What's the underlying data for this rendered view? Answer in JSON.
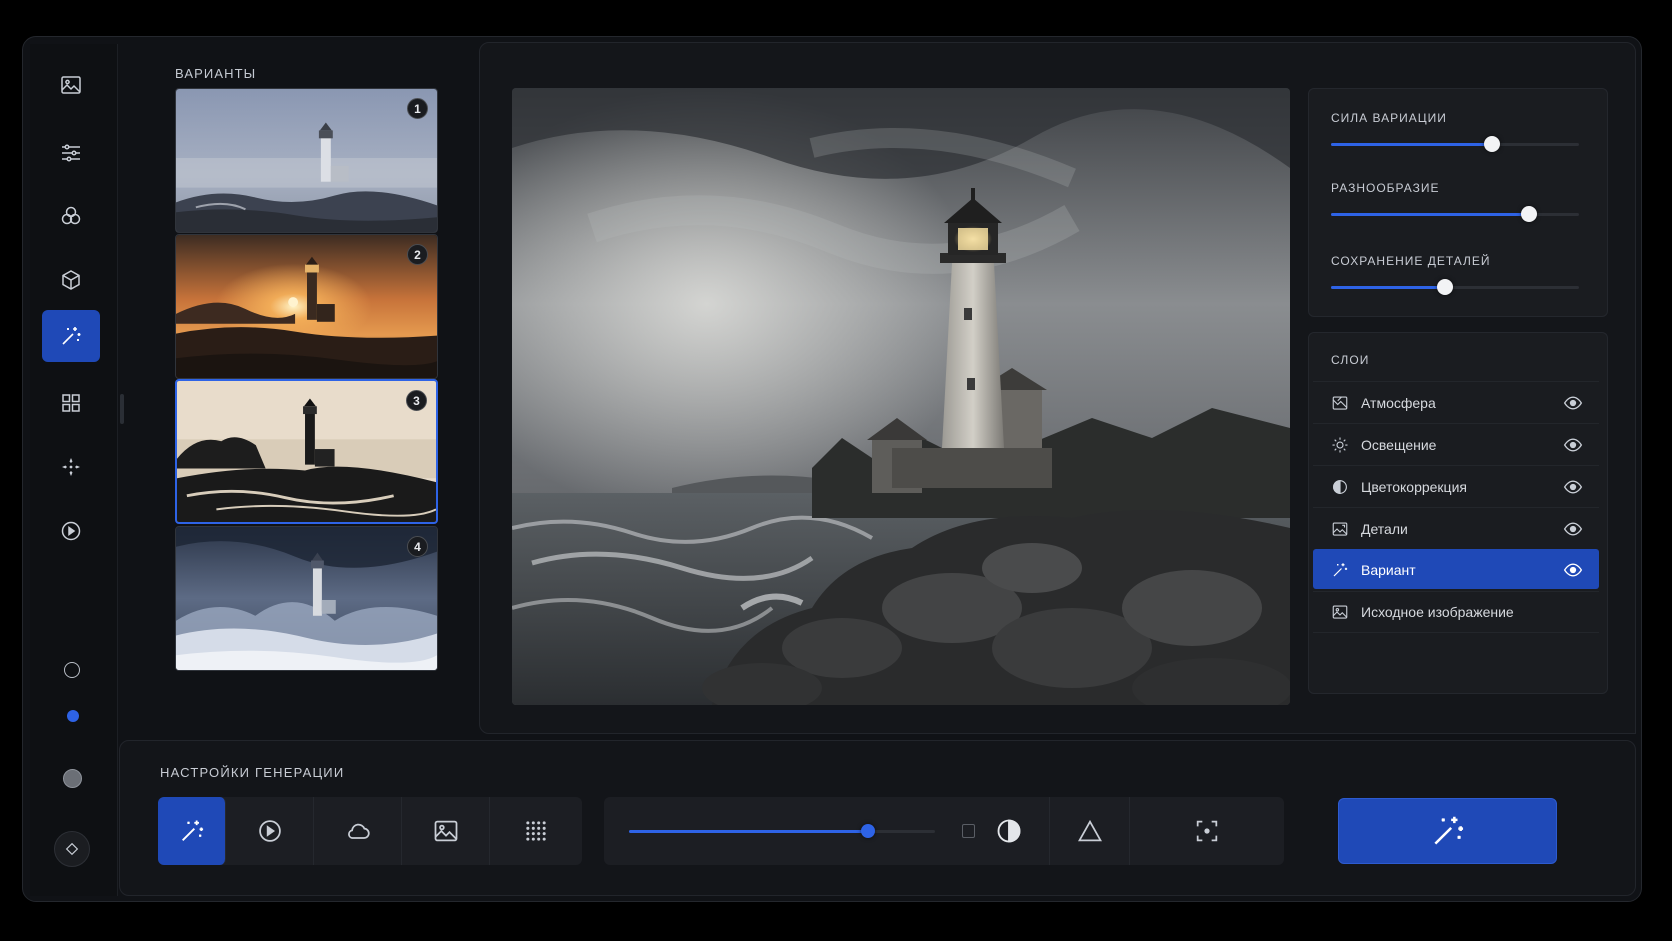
{
  "variants": {
    "title": "ВАРИАНТЫ",
    "items": [
      {
        "number": "1",
        "style": "foggy"
      },
      {
        "number": "2",
        "style": "sunset"
      },
      {
        "number": "3",
        "style": "silhouette"
      },
      {
        "number": "4",
        "style": "storm"
      }
    ],
    "selected": "3"
  },
  "rail": {
    "icons": [
      "image-icon",
      "sliders-icon",
      "blend-icon",
      "cube-icon",
      "magic-wand-icon",
      "grid-icon",
      "sparkle-move-icon",
      "half-circle-play-icon"
    ],
    "active": "magic-wand-icon"
  },
  "controls": {
    "sliders": [
      {
        "label": "СИЛА ВАРИАЦИИ",
        "value": 0.65
      },
      {
        "label": "РАЗНООБРАЗИЕ",
        "value": 0.8
      },
      {
        "label": "СОХРАНЕНИЕ ДЕТАЛЕЙ",
        "value": 0.46
      }
    ]
  },
  "layers": {
    "title": "СЛОИ",
    "items": [
      {
        "name": "Атмосфера",
        "icon": "atmosphere-icon",
        "visible": true
      },
      {
        "name": "Освещение",
        "icon": "sun-icon",
        "visible": true
      },
      {
        "name": "Цветокоррекция",
        "icon": "color-correction-icon",
        "visible": true
      },
      {
        "name": "Детали",
        "icon": "details-icon",
        "visible": true
      },
      {
        "name": "Вариант",
        "icon": "magic-wand-icon",
        "visible": true,
        "active": true
      },
      {
        "name": "Исходное изображение",
        "icon": "image-icon",
        "visible": false
      }
    ]
  },
  "generation": {
    "title": "НАСТРОЙКИ ГЕНЕРАЦИИ",
    "tools": [
      "magic-wand-icon",
      "play-circle-icon",
      "cloud-icon",
      "image-icon",
      "dot-grid-icon"
    ],
    "active_tool": "magic-wand-icon",
    "strength": 0.78,
    "secondary_tools": [
      "square-icon",
      "contrast-icon",
      "triangle-icon",
      "focus-icon"
    ],
    "generate_icon": "magic-wand-icon"
  },
  "colors": {
    "accent": "#1f49b7",
    "accent_bright": "#2e63e6",
    "panel": "#1a1c20",
    "background": "#101216"
  }
}
